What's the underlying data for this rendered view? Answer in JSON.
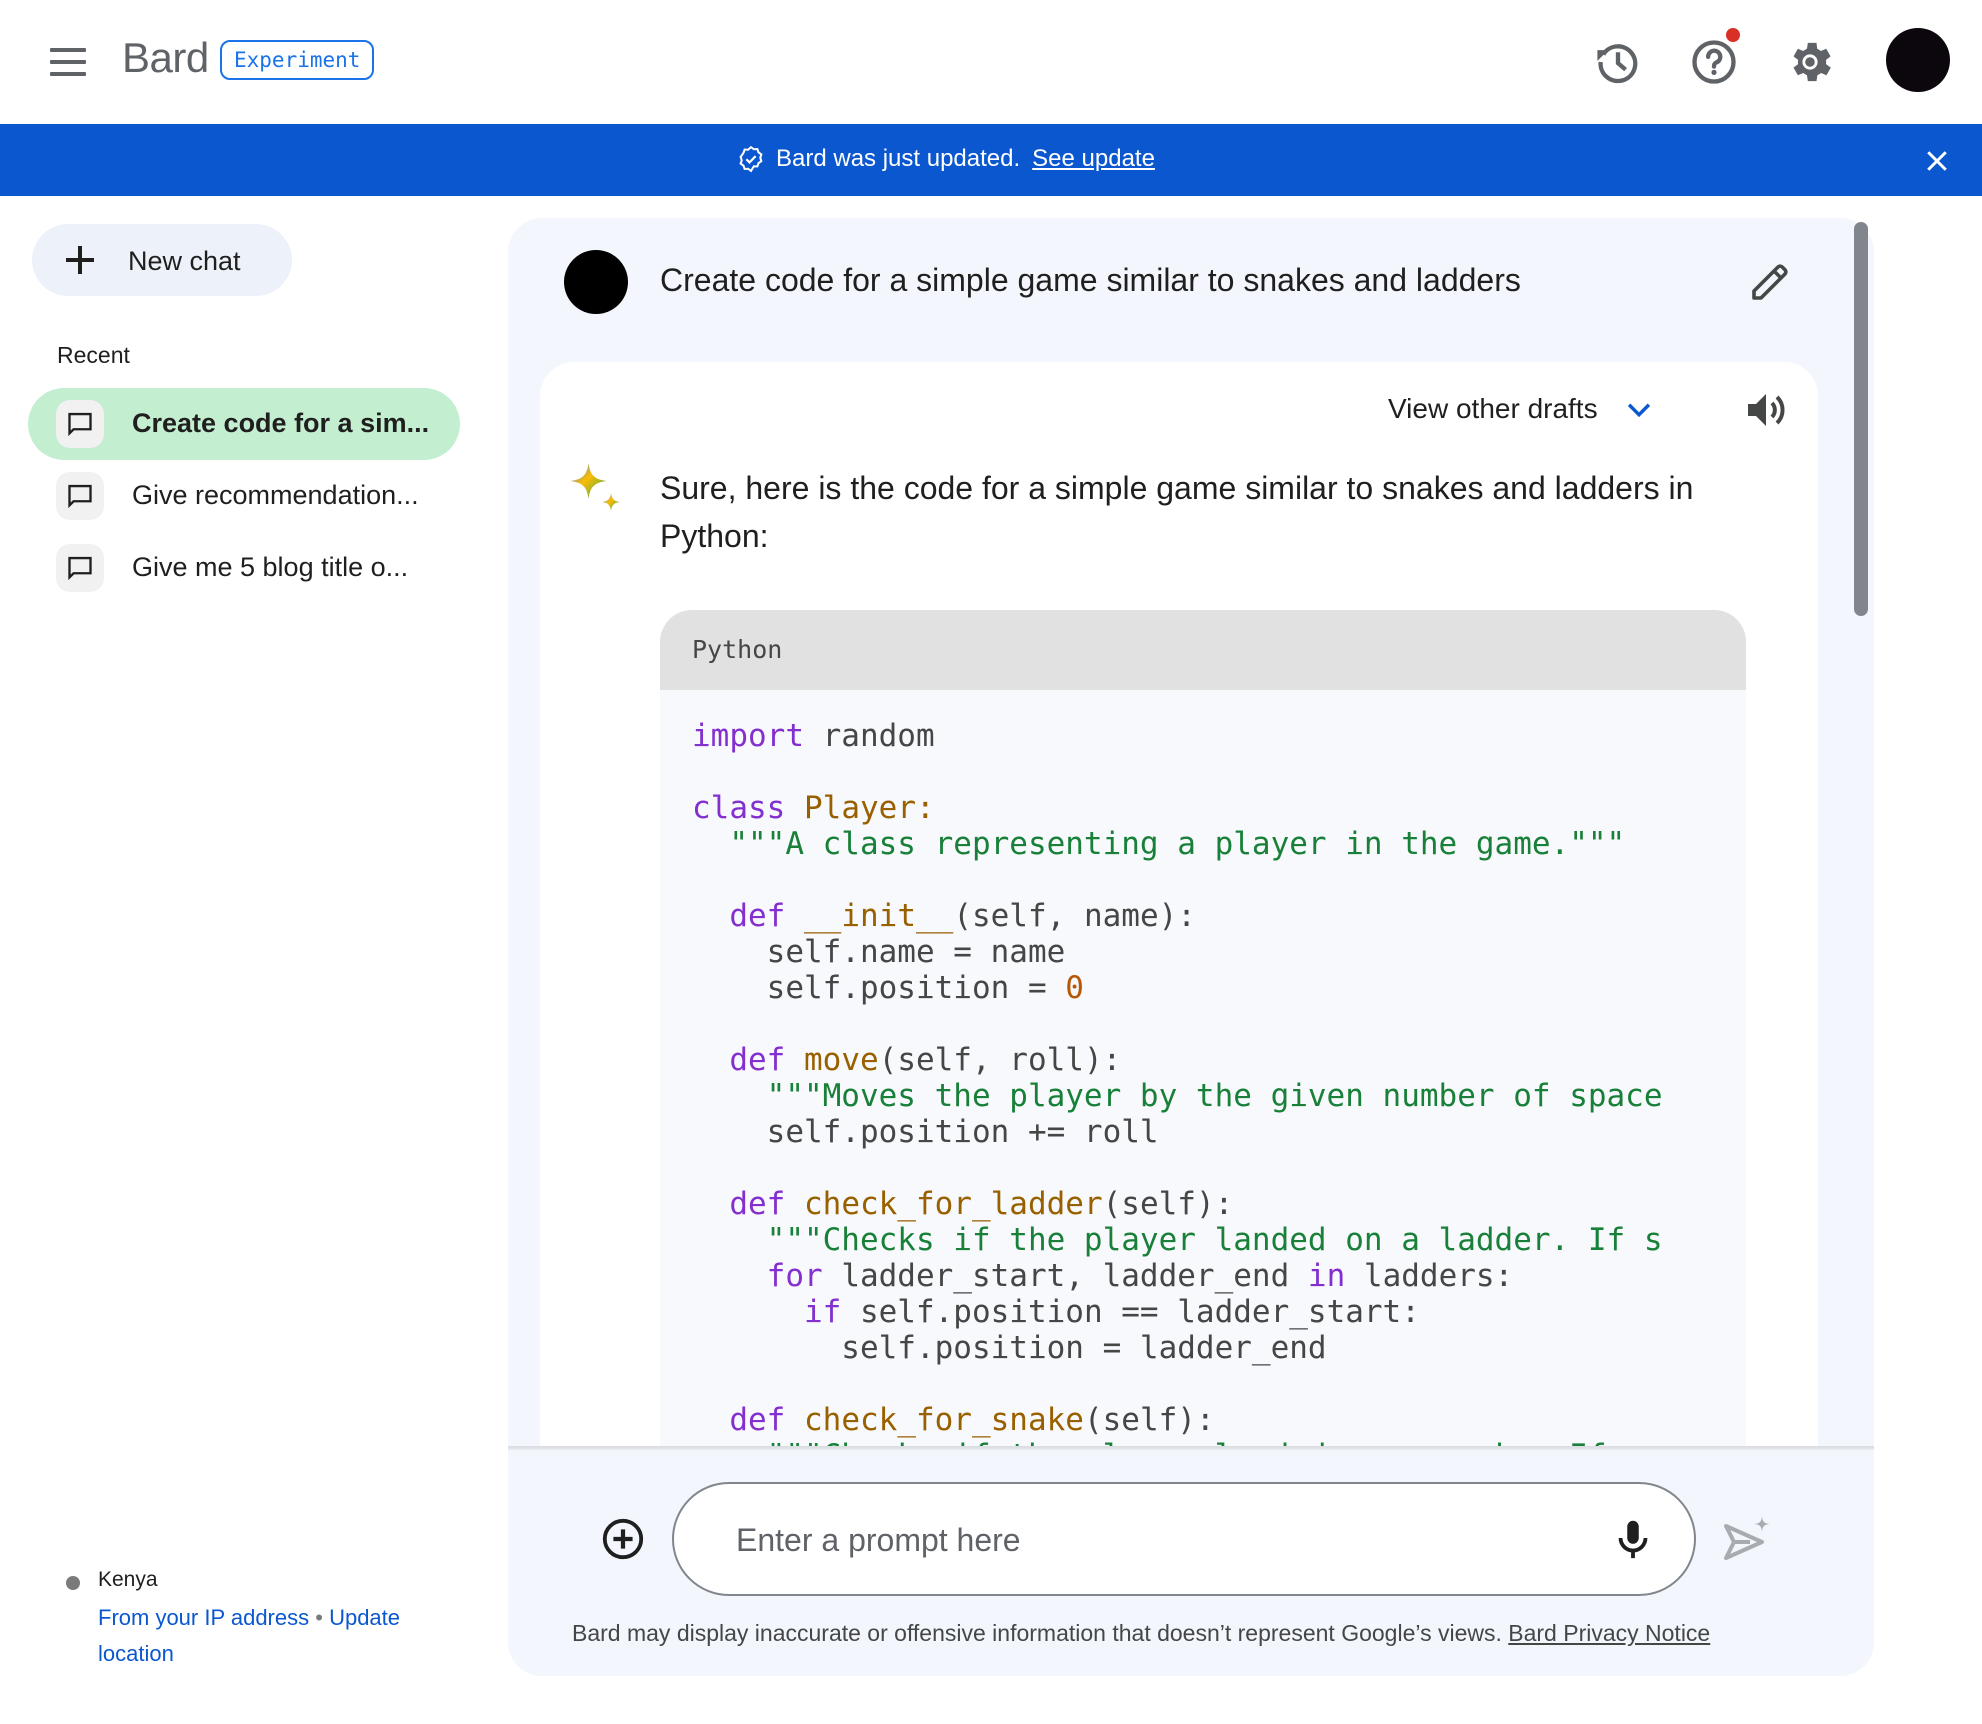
{
  "header": {
    "app_name": "Bard",
    "badge": "Experiment",
    "icons": [
      "menu-icon",
      "history-icon",
      "help-icon",
      "settings-icon",
      "account-avatar"
    ],
    "help_has_notification": true
  },
  "banner": {
    "message": "Bard was just updated.",
    "link": "See update",
    "icon": "verified-badge-icon",
    "close_icon": "close-icon",
    "background": "#0b57d0"
  },
  "sidebar": {
    "new_chat_label": "New chat",
    "recent_title": "Recent",
    "items": [
      {
        "label": "Create code for a sim...",
        "active": true
      },
      {
        "label": "Give recommendation...",
        "active": false
      },
      {
        "label": "Give me 5 blog title o...",
        "active": false
      }
    ],
    "location": {
      "country": "Kenya",
      "source_link": "From your IP address",
      "separator": "•",
      "update_link": "Update location"
    }
  },
  "conversation": {
    "prompt": "Create code for a simple game similar to snakes and ladders",
    "drafts_label": "View other drafts",
    "response_intro": "Sure, here is the code for a simple game similar to snakes and ladders in Python:",
    "code": {
      "language": "Python",
      "lines": [
        [
          {
            "t": "import",
            "c": "kw"
          },
          {
            "t": " random",
            "c": ""
          }
        ],
        [],
        [
          {
            "t": "class",
            "c": "kw"
          },
          {
            "t": " ",
            "c": ""
          },
          {
            "t": "Player:",
            "c": "fn"
          }
        ],
        [
          {
            "t": "  \"\"\"A class representing a player in the game.\"\"\"",
            "c": "str"
          }
        ],
        [],
        [
          {
            "t": "  def",
            "c": "kw"
          },
          {
            "t": " ",
            "c": ""
          },
          {
            "t": "__init__",
            "c": "fn"
          },
          {
            "t": "(self, name):",
            "c": ""
          }
        ],
        [
          {
            "t": "    self.name = name",
            "c": ""
          }
        ],
        [
          {
            "t": "    self.position = ",
            "c": ""
          },
          {
            "t": "0",
            "c": "num"
          }
        ],
        [],
        [
          {
            "t": "  def",
            "c": "kw"
          },
          {
            "t": " ",
            "c": ""
          },
          {
            "t": "move",
            "c": "fn"
          },
          {
            "t": "(self, roll):",
            "c": ""
          }
        ],
        [
          {
            "t": "    \"\"\"Moves the player by the given number of space",
            "c": "str"
          }
        ],
        [
          {
            "t": "    self.position += roll",
            "c": ""
          }
        ],
        [],
        [
          {
            "t": "  def",
            "c": "kw"
          },
          {
            "t": " ",
            "c": ""
          },
          {
            "t": "check_for_ladder",
            "c": "fn"
          },
          {
            "t": "(self):",
            "c": ""
          }
        ],
        [
          {
            "t": "    \"\"\"Checks if the player landed on a ladder. If s",
            "c": "str"
          }
        ],
        [
          {
            "t": "    for",
            "c": "kw"
          },
          {
            "t": " ladder_start, ladder_end ",
            "c": ""
          },
          {
            "t": "in",
            "c": "kw"
          },
          {
            "t": " ladders:",
            "c": ""
          }
        ],
        [
          {
            "t": "      if",
            "c": "kw"
          },
          {
            "t": " self.position == ladder_start:",
            "c": ""
          }
        ],
        [
          {
            "t": "        self.position = ladder_end",
            "c": ""
          }
        ],
        [],
        [
          {
            "t": "  def",
            "c": "kw"
          },
          {
            "t": " ",
            "c": ""
          },
          {
            "t": "check_for_snake",
            "c": "fn"
          },
          {
            "t": "(self):",
            "c": ""
          }
        ],
        [
          {
            "t": "    \"\"\"Checks if the player landed on a snake. If",
            "c": "str"
          }
        ]
      ]
    }
  },
  "input": {
    "placeholder": "Enter a prompt here",
    "value": ""
  },
  "footer": {
    "disclaimer": "Bard may display inaccurate or offensive information that doesn’t represent Google’s views.",
    "privacy_link": "Bard Privacy Notice"
  }
}
